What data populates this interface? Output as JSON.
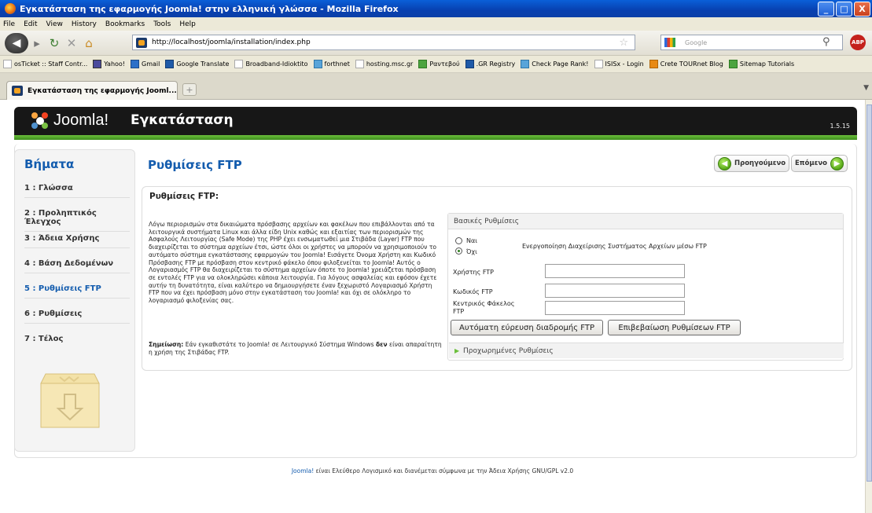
{
  "window": {
    "title": "Εγκατάσταση της εφαρμογής Joomla! στην ελληνική γλώσσα - Mozilla Firefox",
    "controls": [
      "_",
      "□",
      "X"
    ]
  },
  "menu": [
    "File",
    "Edit",
    "View",
    "History",
    "Bookmarks",
    "Tools",
    "Help"
  ],
  "nav": {
    "url": "http://localhost/joomla/installation/index.php",
    "search_placeholder": "Google",
    "abp": "ABP"
  },
  "bookmarks": [
    {
      "label": "osTicket :: Staff Contr...",
      "color": "c0"
    },
    {
      "label": "Yahoo!",
      "color": "c2"
    },
    {
      "label": "Gmail",
      "color": "c3"
    },
    {
      "label": "Google Translate",
      "color": "c5"
    },
    {
      "label": "Broadband-Idioktito",
      "color": "c0"
    },
    {
      "label": "forthnet",
      "color": "c7"
    },
    {
      "label": "hosting.msc.gr",
      "color": "c0"
    },
    {
      "label": "Ραντεβού",
      "color": "c9"
    },
    {
      "label": ".GR Registry",
      "color": "c5"
    },
    {
      "label": "Check Page Rank!",
      "color": "c7"
    },
    {
      "label": "ISISx - Login",
      "color": "c0"
    },
    {
      "label": "Crete TOURnet Blog",
      "color": "c8"
    },
    {
      "label": "Sitemap Tutorials",
      "color": "c9"
    }
  ],
  "tab": {
    "label": "Εγκατάσταση της εφαρμογής Jooml...",
    "new": "+"
  },
  "header": {
    "brand": "Joomla!",
    "title": "Εγκατάσταση",
    "version": "1.5.15"
  },
  "steps": {
    "title": "Βήματα",
    "items": [
      {
        "label": "1 : Γλώσσα",
        "active": false
      },
      {
        "label": "2 : Προληπτικός Έλεγχος",
        "active": false
      },
      {
        "label": "3 : Άδεια Χρήσης",
        "active": false
      },
      {
        "label": "4 : Βάση Δεδομένων",
        "active": false
      },
      {
        "label": "5 : Ρυθμίσεις FTP",
        "active": true
      },
      {
        "label": "6 : Ρυθμίσεις",
        "active": false
      },
      {
        "label": "7 : Τέλος",
        "active": false
      }
    ]
  },
  "main": {
    "title": "Ρυθμίσεις FTP",
    "prev": "Προηγούμενο",
    "next": "Επόμενο",
    "section_title": "Ρυθμίσεις FTP:",
    "description": "Λόγω περιορισμών στα δικαιώματα πρόσβασης αρχείων και φακέλων που επιβάλλονται από τα λειτουργικά συστήματα Linux και άλλα είδη Unix καθώς και εξαιτίας των περιορισμών της Ασφαλούς Λειτουργίας (Safe Mode) της PHP έχει ενσωματωθεί μια Στιβάδα (Layer) FTP που διαχειρίζεται το σύστημα αρχείων έτσι, ώστε όλοι οι χρήστες να μπορούν να χρησιμοποιούν το αυτόματο σύστημα εγκατάστασης εφαρμογών του Joomla! Εισάγετε Όνομα Χρήστη και Κωδικό Πρόσβασης FTP με πρόσβαση στον κεντρικό φάκελο όπου φιλοξενείται το Joomla! Αυτός ο Λογαριασμός FTP θα διαχειρίζεται το σύστημα αρχείων όποτε το Joomla! χρειάζεται πρόσβαση σε εντολές FTP για να ολοκληρώσει κάποια λειτουργία. Για λόγους ασφαλείας και εφόσον έχετε αυτήν τη δυνατότητα, είναι καλύτερο να δημιουργήσετε έναν ξεχωριστό Λογαριασμό Χρήστη FTP που να έχει πρόσβαση μόνο στην εγκατάσταση του Joomla! και όχι σε ολόκληρο το λογαριασμό φιλοξενίας σας.",
    "note_bold": "Σημείωση:",
    "note_pre": " Εάν εγκαθιστάτε το Joomla! σε Λειτουργικό Σύστημα Windows ",
    "note_emph": "δεν",
    "note_post": " είναι απαραίτητη η χρήση της Στιβάδας FTP."
  },
  "basic": {
    "title": "Βασικές Ρυθμίσεις",
    "yes": "Ναι",
    "no": "Όχι",
    "enable_label": "Ενεργοποίηση Διαχείρισης Συστήματος Αρχείων μέσω FTP",
    "user_label": "Χρήστης FTP",
    "pass_label": "Κωδικός FTP",
    "root_label_1": "Κεντρικός Φάκελος",
    "root_label_2": "FTP",
    "user_value": "",
    "pass_value": "",
    "root_value": "",
    "autofind_btn": "Αυτόματη εύρευση διαδρομής FTP",
    "verify_btn": "Επιβεβαίωση Ρυθμίσεων FTP",
    "advanced": "Προχωρημένες Ρυθμίσεις"
  },
  "footer": {
    "link": "Joomla!",
    "text": " είναι Ελεύθερο Λογισμικό και διανέμεται σύμφωνα με την Άδεια Χρήσης GNU/GPL v2.0"
  },
  "colors": {
    "accent": "#135cae",
    "green": "#6bbf3c",
    "header": "#171717"
  }
}
